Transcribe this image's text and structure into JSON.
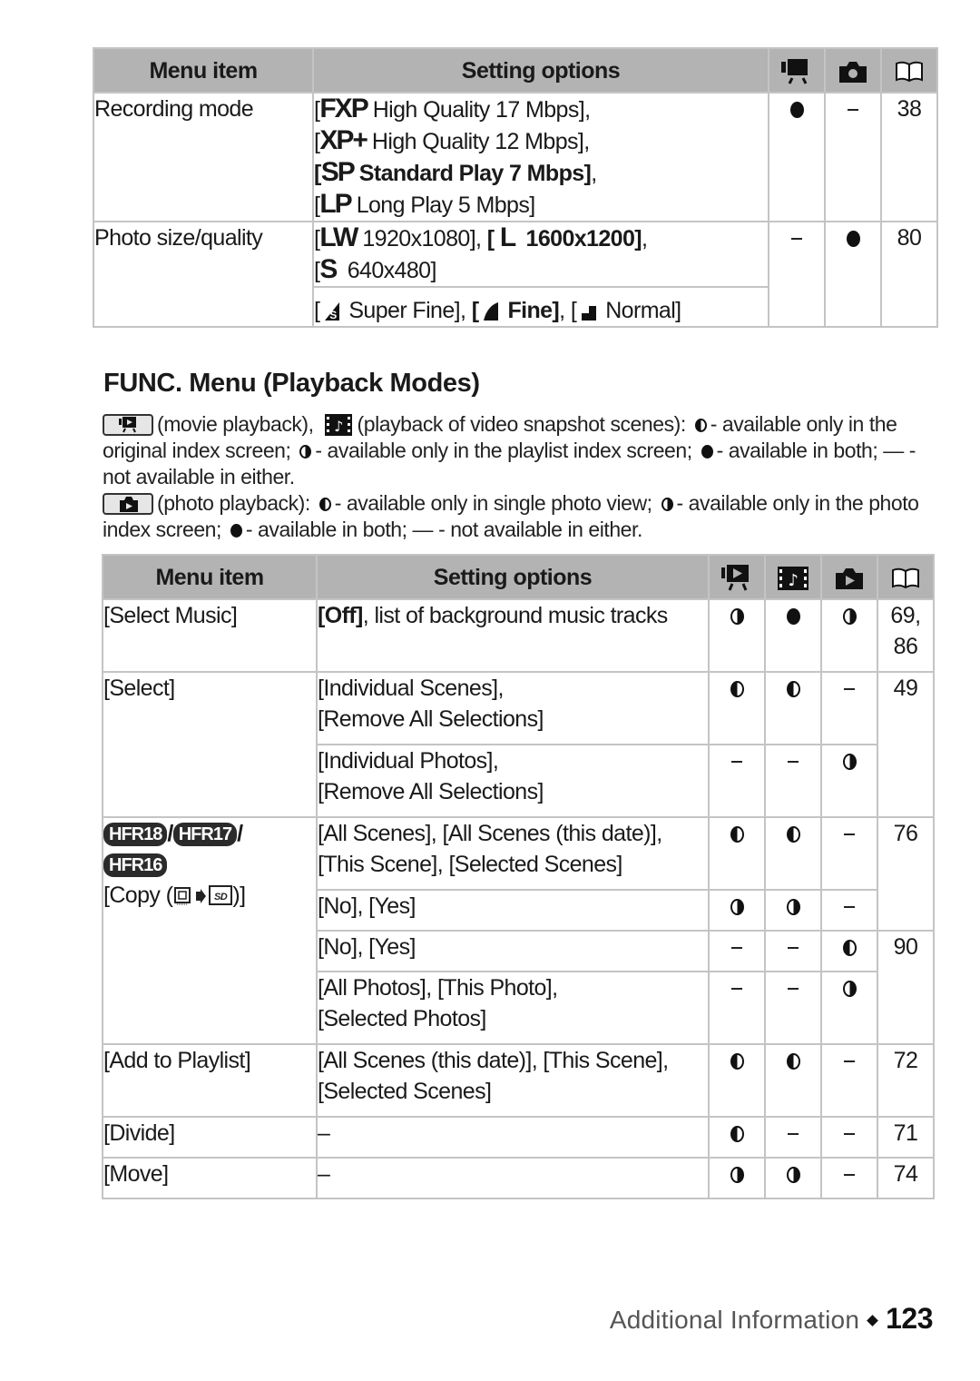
{
  "table1": {
    "headers": {
      "menu_item": "Menu item",
      "setting_options": "Setting options",
      "col_icons": [
        "movie-camera-icon",
        "photo-camera-icon",
        "reference-page-book-icon"
      ]
    },
    "rows": [
      {
        "menu_item": "Recording mode",
        "options": [
          {
            "glyph": "FXP",
            "text": "High Quality 17 Mbps],",
            "bold": false
          },
          {
            "glyph": "XP+",
            "text": "High Quality 12 Mbps],",
            "bold": false
          },
          {
            "glyph": "SP",
            "text": "Standard Play 7 Mbps]",
            "suffix": ",",
            "bold": true
          },
          {
            "glyph": "LP",
            "text": "Long Play 5 Mbps]",
            "bold": false
          }
        ],
        "movie": "full",
        "photo": "none",
        "ref": "38"
      },
      {
        "menu_item": "Photo size/quality",
        "options_size": [
          {
            "glyph": "LW",
            "text": "1920x1080],",
            "bold": false
          },
          {
            "glyph": "L",
            "text": "1600x1200]",
            "suffix": ",",
            "bold": true
          },
          {
            "glyph": "S",
            "text": "640x480]",
            "bold": false
          }
        ],
        "options_quality": [
          {
            "icon": "super-fine-quality-icon",
            "text": "Super Fine],",
            "bold": false
          },
          {
            "icon": "fine-quality-icon",
            "text": "Fine]",
            "suffix": ",",
            "bold": true
          },
          {
            "icon": "normal-quality-icon",
            "text": "Normal]",
            "bold": false
          }
        ],
        "movie": "none",
        "photo": "full",
        "ref": "80"
      }
    ]
  },
  "section_title": "FUNC. Menu (Playback Modes)",
  "legend": {
    "movie_playback": "(movie playback),",
    "snapshot_playback": "(playback of video snapshot scenes):",
    "left_half_movie": "- available only in the original index screen;",
    "right_half_movie": "- available only in the playlist index screen;",
    "full_movie": "- available in both;",
    "dash_movie": "- not available in either.",
    "photo_playback": "(photo playback):",
    "left_half_photo": "- available only in single photo view;",
    "right_half_photo": "- available only in the photo index screen;",
    "full_photo": "- available in both;",
    "dash_photo": "- not available in either.",
    "dash_symbol": "—"
  },
  "table2": {
    "headers": {
      "menu_item": "Menu item",
      "setting_options": "Setting options",
      "col_icons": [
        "movie-playback-icon",
        "video-snapshot-playback-icon",
        "photo-playback-icon",
        "reference-page-book-icon"
      ]
    },
    "select_music": {
      "item": "[Select Music]",
      "opt_bold": "[Off]",
      "opt_rest": ", list of background music tracks",
      "marks": [
        "right",
        "full",
        "right"
      ],
      "ref": "69, 86"
    },
    "select": {
      "item": "[Select]",
      "sub": [
        {
          "opt1": "[Individual Scenes],",
          "opt2": "[Remove All Selections]",
          "marks": [
            "left",
            "left",
            "none"
          ]
        },
        {
          "opt1": "[Individual Photos],",
          "opt2": "[Remove All Selections]",
          "marks": [
            "none",
            "none",
            "right"
          ]
        }
      ],
      "ref": "49"
    },
    "copy": {
      "models": [
        "HFR18",
        "HFR17",
        "HFR16"
      ],
      "item_prefix": "[Copy (",
      "item_suffix": ")]",
      "sub": [
        {
          "opt1": "[All Scenes], [All Scenes (this date)],",
          "opt2": "[This Scene], [Selected Scenes]",
          "marks": [
            "left",
            "left",
            "none"
          ]
        },
        {
          "opt1": "[No], [Yes]",
          "marks": [
            "right",
            "right",
            "none"
          ]
        },
        {
          "opt1": "[No], [Yes]",
          "marks": [
            "none",
            "none",
            "left"
          ]
        },
        {
          "opt1": "[All Photos], [This Photo],",
          "opt2": "[Selected Photos]",
          "marks": [
            "none",
            "none",
            "right"
          ]
        }
      ],
      "ref_scenes": "76",
      "ref_photos": "90"
    },
    "add_to_playlist": {
      "item": "[Add to Playlist]",
      "opt1": "[All Scenes (this date)], [This Scene],",
      "opt2": "[Selected Scenes]",
      "marks": [
        "left",
        "left",
        "none"
      ],
      "ref": "72"
    },
    "divide": {
      "item": "[Divide]",
      "opt": "–",
      "marks": [
        "left",
        "none",
        "none"
      ],
      "ref": "71"
    },
    "move": {
      "item": "[Move]",
      "opt": "–",
      "marks": [
        "right",
        "right",
        "none"
      ],
      "ref": "74"
    }
  },
  "footer": {
    "section": "Additional Information",
    "page_number": "123"
  }
}
